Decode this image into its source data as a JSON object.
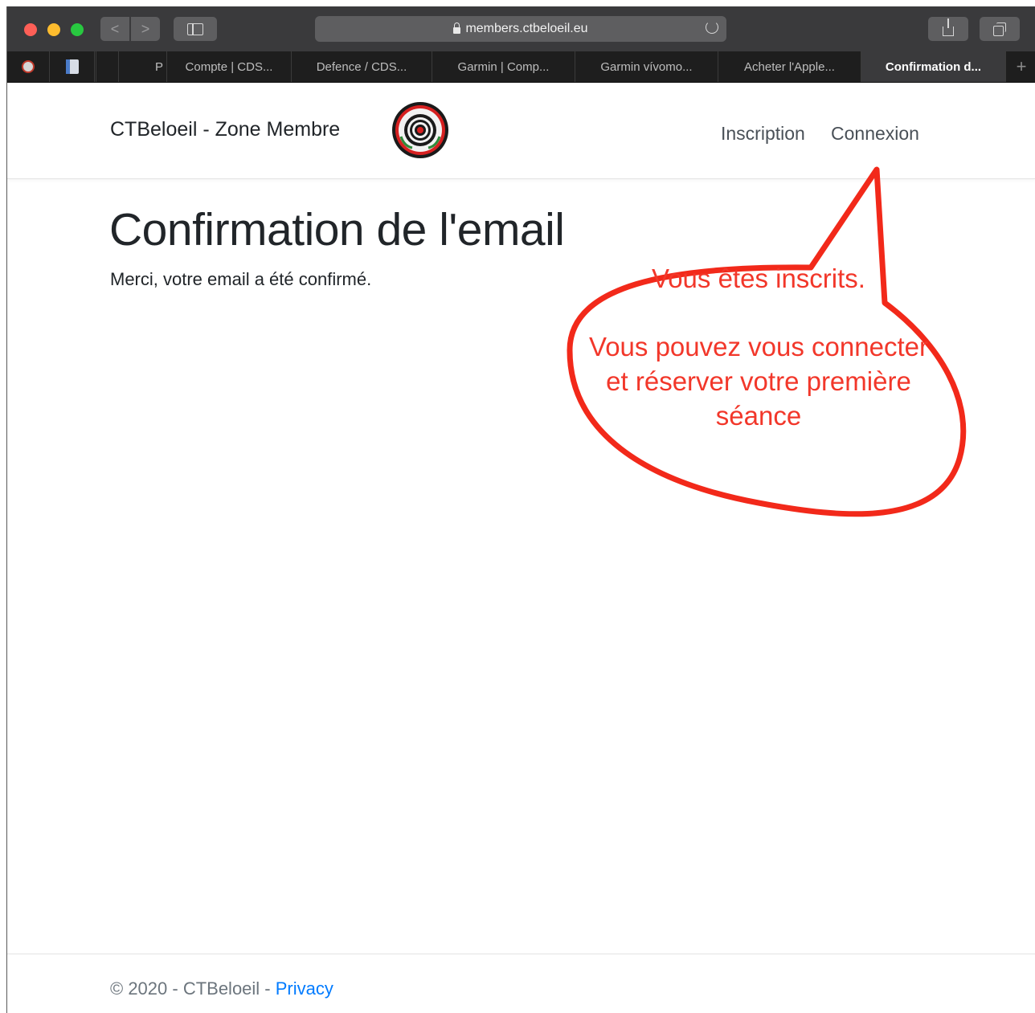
{
  "browser": {
    "url": "members.ctbeloeil.eu",
    "tabs": [
      {
        "label": "P"
      },
      {
        "label": "Compte | CDS..."
      },
      {
        "label": "Defence / CDS..."
      },
      {
        "label": "Garmin | Comp..."
      },
      {
        "label": "Garmin vívomo..."
      },
      {
        "label": "Acheter l'Apple..."
      },
      {
        "label": "Confirmation d...",
        "active": true
      }
    ],
    "new_tab_label": "+",
    "back_label": "<",
    "forward_label": ">"
  },
  "header": {
    "brand": "CTBeloeil - Zone Membre",
    "nav": {
      "inscription": "Inscription",
      "connexion": "Connexion"
    }
  },
  "main": {
    "title": "Confirmation de l'email",
    "message": "Merci, votre email a été confirmé."
  },
  "callout": {
    "line1": "Vous êtes inscrits.",
    "line2": "Vous pouvez vous connecter et réserver votre première séance",
    "color": "#f2372a"
  },
  "footer": {
    "copyright": "© 2020 - CTBeloeil - ",
    "privacy_link": "Privacy"
  },
  "colors": {
    "link": "#007bff",
    "toolbar": "#3a3a3c",
    "tabbar": "#1e1e1e"
  }
}
